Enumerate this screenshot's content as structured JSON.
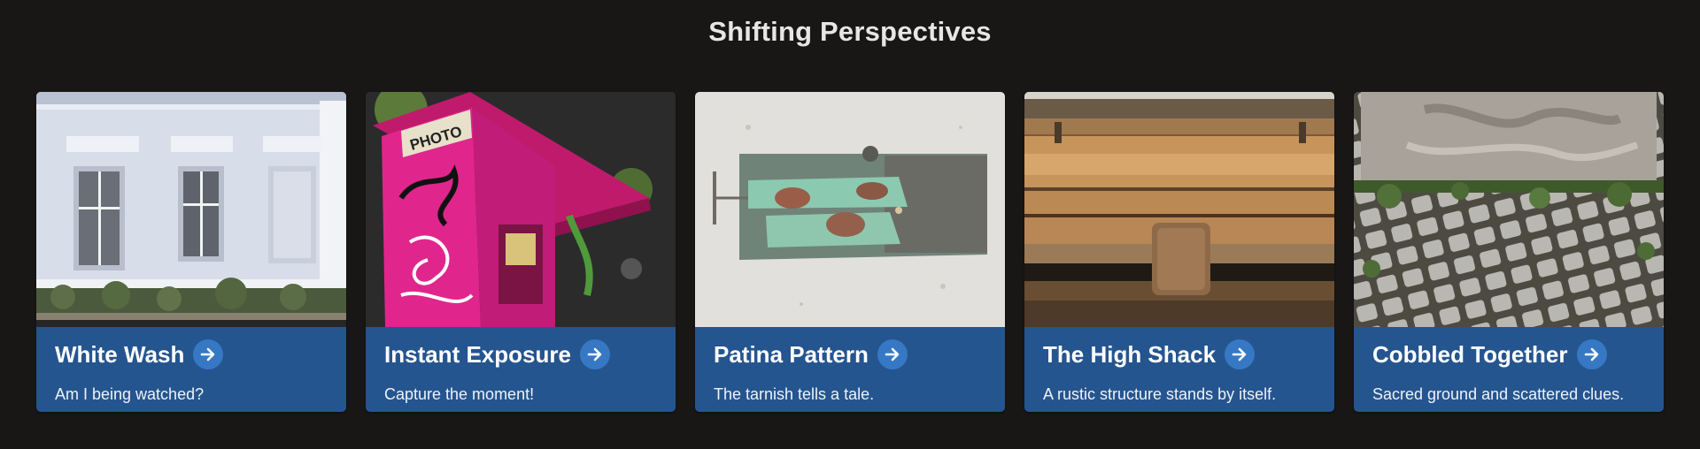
{
  "page": {
    "title": "Shifting Perspectives"
  },
  "cards": [
    {
      "title": "White Wash",
      "description": "Am I being watched?",
      "image": "white-building-facade"
    },
    {
      "title": "Instant Exposure",
      "description": "Capture the moment!",
      "image": "pink-photo-booth"
    },
    {
      "title": "Patina Pattern",
      "description": "The tarnish tells a tale.",
      "image": "patina-plaque"
    },
    {
      "title": "The High Shack",
      "description": "A rustic structure stands by itself.",
      "image": "wooden-shack"
    },
    {
      "title": "Cobbled Together",
      "description": "Sacred ground and scattered clues.",
      "image": "cobblestones"
    }
  ],
  "colors": {
    "background": "#181716",
    "card_footer": "#25558f",
    "arrow_badge": "#3678c4",
    "title_text": "#e6e6e6"
  },
  "icons": {
    "card_link": "arrow-right-icon"
  }
}
